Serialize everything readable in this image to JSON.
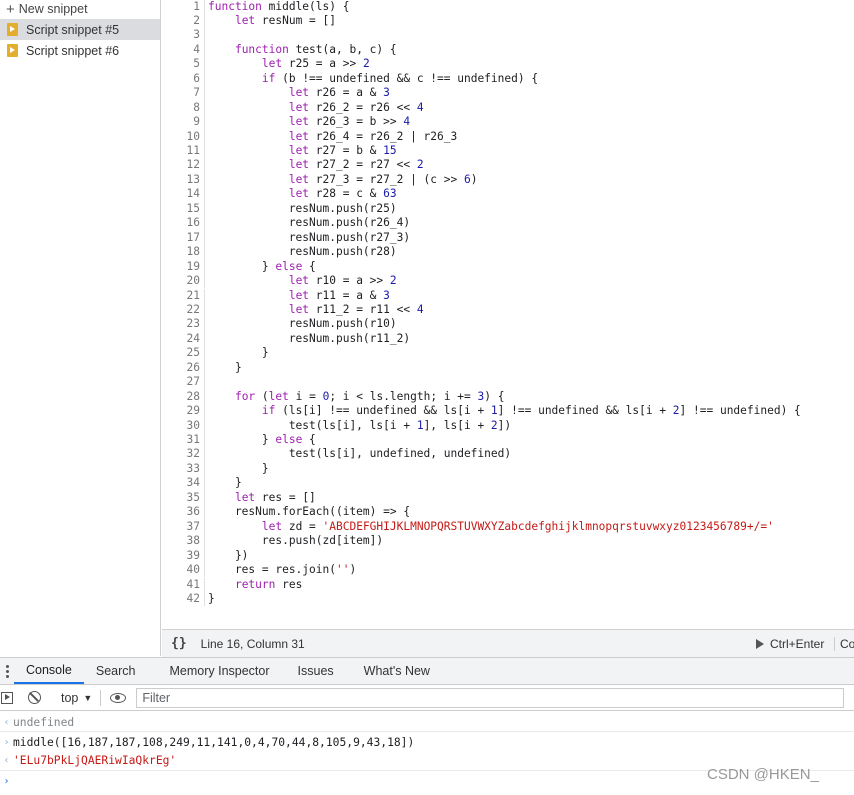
{
  "sidebar": {
    "new_snippet_label": "New snippet",
    "items": [
      {
        "label": "Script snippet #5",
        "selected": true
      },
      {
        "label": "Script snippet #6",
        "selected": false
      }
    ]
  },
  "editor": {
    "lines": [
      [
        {
          "t": "function",
          "c": "kw"
        },
        {
          "t": " middle(ls) {"
        }
      ],
      [
        {
          "t": "    "
        },
        {
          "t": "let",
          "c": "kw"
        },
        {
          "t": " resNum = []"
        }
      ],
      [
        {
          "t": ""
        }
      ],
      [
        {
          "t": "    "
        },
        {
          "t": "function",
          "c": "kw"
        },
        {
          "t": " test(a, b, c) {"
        }
      ],
      [
        {
          "t": "        "
        },
        {
          "t": "let",
          "c": "kw"
        },
        {
          "t": " r25 = a >> "
        },
        {
          "t": "2",
          "c": "num"
        }
      ],
      [
        {
          "t": "        "
        },
        {
          "t": "if",
          "c": "kw"
        },
        {
          "t": " (b !== undefined && c !== undefined) {"
        }
      ],
      [
        {
          "t": "            "
        },
        {
          "t": "let",
          "c": "kw"
        },
        {
          "t": " r26 = a & "
        },
        {
          "t": "3",
          "c": "num"
        }
      ],
      [
        {
          "t": "            "
        },
        {
          "t": "let",
          "c": "kw"
        },
        {
          "t": " r26_2 = r26 << "
        },
        {
          "t": "4",
          "c": "num"
        }
      ],
      [
        {
          "t": "            "
        },
        {
          "t": "let",
          "c": "kw"
        },
        {
          "t": " r26_3 = b >> "
        },
        {
          "t": "4",
          "c": "num"
        }
      ],
      [
        {
          "t": "            "
        },
        {
          "t": "let",
          "c": "kw"
        },
        {
          "t": " r26_4 = r26_2 | r26_3"
        }
      ],
      [
        {
          "t": "            "
        },
        {
          "t": "let",
          "c": "kw"
        },
        {
          "t": " r27 = b & "
        },
        {
          "t": "15",
          "c": "num"
        }
      ],
      [
        {
          "t": "            "
        },
        {
          "t": "let",
          "c": "kw"
        },
        {
          "t": " r27_2 = r27 << "
        },
        {
          "t": "2",
          "c": "num"
        }
      ],
      [
        {
          "t": "            "
        },
        {
          "t": "let",
          "c": "kw"
        },
        {
          "t": " r27_3 = r27_2 | (c >> "
        },
        {
          "t": "6",
          "c": "num"
        },
        {
          "t": ")"
        }
      ],
      [
        {
          "t": "            "
        },
        {
          "t": "let",
          "c": "kw"
        },
        {
          "t": " r28 = c & "
        },
        {
          "t": "63",
          "c": "num"
        }
      ],
      [
        {
          "t": "            resNum.push(r25)"
        }
      ],
      [
        {
          "t": "            resNum.push(r26_4)"
        }
      ],
      [
        {
          "t": "            resNum.push(r27_3)"
        }
      ],
      [
        {
          "t": "            resNum.push(r28)"
        }
      ],
      [
        {
          "t": "        } "
        },
        {
          "t": "else",
          "c": "kw"
        },
        {
          "t": " {"
        }
      ],
      [
        {
          "t": "            "
        },
        {
          "t": "let",
          "c": "kw"
        },
        {
          "t": " r10 = a >> "
        },
        {
          "t": "2",
          "c": "num"
        }
      ],
      [
        {
          "t": "            "
        },
        {
          "t": "let",
          "c": "kw"
        },
        {
          "t": " r11 = a & "
        },
        {
          "t": "3",
          "c": "num"
        }
      ],
      [
        {
          "t": "            "
        },
        {
          "t": "let",
          "c": "kw"
        },
        {
          "t": " r11_2 = r11 << "
        },
        {
          "t": "4",
          "c": "num"
        }
      ],
      [
        {
          "t": "            resNum.push(r10)"
        }
      ],
      [
        {
          "t": "            resNum.push(r11_2)"
        }
      ],
      [
        {
          "t": "        }"
        }
      ],
      [
        {
          "t": "    }"
        }
      ],
      [
        {
          "t": ""
        }
      ],
      [
        {
          "t": "    "
        },
        {
          "t": "for",
          "c": "kw"
        },
        {
          "t": " ("
        },
        {
          "t": "let",
          "c": "kw"
        },
        {
          "t": " i = "
        },
        {
          "t": "0",
          "c": "num"
        },
        {
          "t": "; i < ls.length; i += "
        },
        {
          "t": "3",
          "c": "num"
        },
        {
          "t": ") {"
        }
      ],
      [
        {
          "t": "        "
        },
        {
          "t": "if",
          "c": "kw"
        },
        {
          "t": " (ls[i] !== undefined && ls[i + "
        },
        {
          "t": "1",
          "c": "num"
        },
        {
          "t": "] !== undefined && ls[i + "
        },
        {
          "t": "2",
          "c": "num"
        },
        {
          "t": "] !== undefined) {"
        }
      ],
      [
        {
          "t": "            test(ls[i], ls[i + "
        },
        {
          "t": "1",
          "c": "num"
        },
        {
          "t": "], ls[i + "
        },
        {
          "t": "2",
          "c": "num"
        },
        {
          "t": "])"
        }
      ],
      [
        {
          "t": "        } "
        },
        {
          "t": "else",
          "c": "kw"
        },
        {
          "t": " {"
        }
      ],
      [
        {
          "t": "            test(ls[i], undefined, undefined)"
        }
      ],
      [
        {
          "t": "        }"
        }
      ],
      [
        {
          "t": "    }"
        }
      ],
      [
        {
          "t": "    "
        },
        {
          "t": "let",
          "c": "kw"
        },
        {
          "t": " res = []"
        }
      ],
      [
        {
          "t": "    resNum.forEach((item) => {"
        }
      ],
      [
        {
          "t": "        "
        },
        {
          "t": "let",
          "c": "kw"
        },
        {
          "t": " zd = "
        },
        {
          "t": "'ABCDEFGHIJKLMNOPQRSTUVWXYZabcdefghijklmnopqrstuvwxyz0123456789+/='",
          "c": "str"
        }
      ],
      [
        {
          "t": "        res.push(zd[item])"
        }
      ],
      [
        {
          "t": "    })"
        }
      ],
      [
        {
          "t": "    res = res.join("
        },
        {
          "t": "''",
          "c": "str"
        },
        {
          "t": ")"
        }
      ],
      [
        {
          "t": "    "
        },
        {
          "t": "return",
          "c": "kw"
        },
        {
          "t": " res"
        }
      ],
      [
        {
          "t": "}"
        }
      ]
    ]
  },
  "statusbar": {
    "braces": "{}",
    "position": "Line 16, Column 31",
    "run_label": "Ctrl+Enter",
    "coverage_label": "Cov"
  },
  "drawer": {
    "tabs": [
      "Console",
      "Search",
      "Memory Inspector",
      "Issues",
      "What's New"
    ],
    "active_tab": "Console"
  },
  "console_toolbar": {
    "context": "top",
    "filter_placeholder": "Filter"
  },
  "console": {
    "undefined_line": "undefined",
    "input_line": "middle([16,187,187,108,249,11,141,0,4,70,44,8,105,9,43,18])",
    "result_line": "'ELu7bPkLjQAERiwIaQkrEg'"
  },
  "watermark": "CSDN @HKEN_",
  "colors": {
    "keyword": "#9e1fb0",
    "number": "#1a1aa6",
    "string": "#c41a16",
    "active_tab": "#1a73e8",
    "snippet_icon": "#e3ad2e"
  }
}
